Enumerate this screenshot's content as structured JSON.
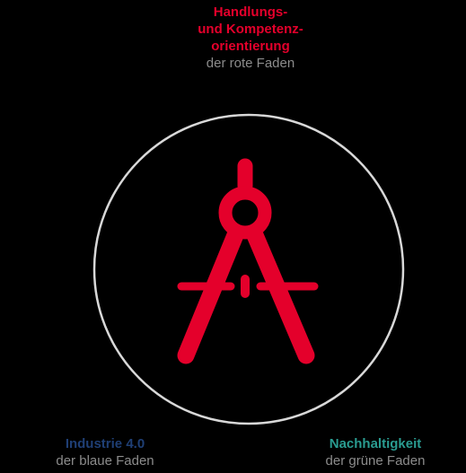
{
  "top": {
    "title_lines": [
      "Handlungs-",
      "und Kompetenz-",
      "orientierung"
    ],
    "subtitle": "der rote Faden"
  },
  "bottom_left": {
    "title": "Industrie 4.0",
    "subtitle": "der blaue Faden"
  },
  "bottom_right": {
    "title": "Nachhaltigkeit",
    "subtitle": "der grüne Faden"
  },
  "colors": {
    "red": "#e4002b",
    "blue": "#1f3f75",
    "teal": "#2a9c91",
    "grey": "#8c8c8c",
    "circle": "#d8d8d8"
  },
  "icons": {
    "center": "drawing-compass-icon"
  }
}
